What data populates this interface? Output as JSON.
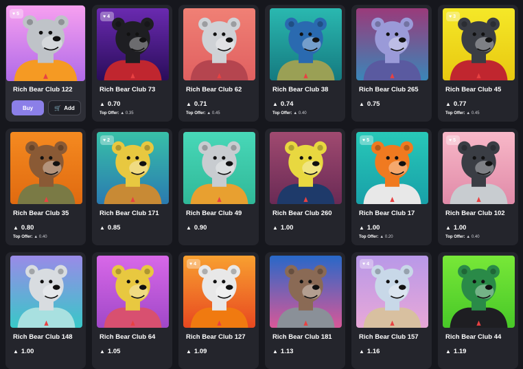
{
  "currency_symbol": "▲",
  "buttons": {
    "buy": "Buy",
    "add": "Add"
  },
  "offer_label": "Top Offer:",
  "cards": [
    {
      "name": "Rich Bear Club 122",
      "price": "",
      "likes": "5",
      "top_offer": "",
      "bg": [
        "#f7a0f0",
        "#b06ae8"
      ],
      "fur": "#bfc3c8",
      "shirt": "#f59a23",
      "hover": true
    },
    {
      "name": "Rich Bear Club 73",
      "price": "0.70",
      "likes": "4",
      "top_offer": "0.35",
      "bg": [
        "#6a2ab0",
        "#2a0d5a"
      ],
      "fur": "#1e1e22",
      "shirt": "#c0262f",
      "hover": false
    },
    {
      "name": "Rich Bear Club 62",
      "price": "0.71",
      "likes": "",
      "top_offer": "0.45",
      "bg": [
        "#f08075",
        "#e06060"
      ],
      "fur": "#cfd2d6",
      "shirt": "#b5454f",
      "hover": false
    },
    {
      "name": "Rich Bear Club 38",
      "price": "0.74",
      "likes": "",
      "top_offer": "0.40",
      "bg": [
        "#2ab8b0",
        "#157a80"
      ],
      "fur": "#2a6ab0",
      "shirt": "#9aa055",
      "hover": false
    },
    {
      "name": "Rich Bear Club 265",
      "price": "0.75",
      "likes": "",
      "top_offer": "",
      "bg": [
        "#9a3a7a",
        "#3a86b8"
      ],
      "fur": "#9a9ad8",
      "shirt": "#5a5aa0",
      "hover": false
    },
    {
      "name": "Rich Bear Club 45",
      "price": "0.77",
      "likes": "3",
      "top_offer": "0.45",
      "bg": [
        "#f5e828",
        "#e8c810"
      ],
      "fur": "#3a3d44",
      "shirt": "#c0262f",
      "hover": false
    },
    {
      "name": "Rich Bear Club 35",
      "price": "0.80",
      "likes": "",
      "top_offer": "0.40",
      "bg": [
        "#f58a20",
        "#e06a10"
      ],
      "fur": "#8a5a35",
      "shirt": "#7a7a45",
      "hover": false
    },
    {
      "name": "Rich Bear Club 171",
      "price": "0.85",
      "likes": "2",
      "top_offer": "",
      "bg": [
        "#38c0a8",
        "#2a7ab0"
      ],
      "fur": "#e8c840",
      "shirt": "#c88a35",
      "hover": false
    },
    {
      "name": "Rich Bear Club 49",
      "price": "0.90",
      "likes": "",
      "top_offer": "",
      "bg": [
        "#48d8b8",
        "#30b898"
      ],
      "fur": "#c8ccd0",
      "shirt": "#e8a030",
      "hover": false
    },
    {
      "name": "Rich Bear Club 260",
      "price": "1.00",
      "likes": "",
      "top_offer": "",
      "bg": [
        "#a04a70",
        "#6a2a55"
      ],
      "fur": "#e8d840",
      "shirt": "#1e3a6a",
      "hover": false
    },
    {
      "name": "Rich Bear Club 17",
      "price": "1.00",
      "likes": "5",
      "top_offer": "0.20",
      "bg": [
        "#28c8b8",
        "#18a0a8"
      ],
      "fur": "#f07a20",
      "shirt": "#e8e8e8",
      "hover": false
    },
    {
      "name": "Rich Bear Club 102",
      "price": "1.00",
      "likes": "5",
      "top_offer": "0.40",
      "bg": [
        "#f8b8c8",
        "#e08aa8"
      ],
      "fur": "#3a3d44",
      "shirt": "#c8ccd0",
      "hover": false
    },
    {
      "name": "Rich Bear Club 148",
      "price": "1.00",
      "likes": "",
      "top_offer": "",
      "bg": [
        "#9a8ae8",
        "#38c8c8"
      ],
      "fur": "#d8dce0",
      "shirt": "#a8e0e0",
      "hover": false
    },
    {
      "name": "Rich Bear Club 64",
      "price": "1.05",
      "likes": "",
      "top_offer": "",
      "bg": [
        "#d868e8",
        "#a048c8"
      ],
      "fur": "#e8c840",
      "shirt": "#d85070",
      "hover": false
    },
    {
      "name": "Rich Bear Club 127",
      "price": "1.09",
      "likes": "4",
      "top_offer": "",
      "bg": [
        "#f8a030",
        "#e84820"
      ],
      "fur": "#e8e8e8",
      "shirt": "#f07a10",
      "hover": false
    },
    {
      "name": "Rich Bear Club 181",
      "price": "1.13",
      "likes": "",
      "top_offer": "",
      "bg": [
        "#2868c8",
        "#d85898"
      ],
      "fur": "#8a6a55",
      "shirt": "#8a9098",
      "hover": false
    },
    {
      "name": "Rich Bear Club 157",
      "price": "1.16",
      "likes": "4",
      "top_offer": "",
      "bg": [
        "#b898e8",
        "#e8a8d8"
      ],
      "fur": "#c8d8e8",
      "shirt": "#d8c0a0",
      "hover": false
    },
    {
      "name": "Rich Bear Club 44",
      "price": "1.19",
      "likes": "",
      "top_offer": "",
      "bg": [
        "#78e838",
        "#48c828"
      ],
      "fur": "#2a8a48",
      "shirt": "#1e1e22",
      "hover": false
    }
  ]
}
